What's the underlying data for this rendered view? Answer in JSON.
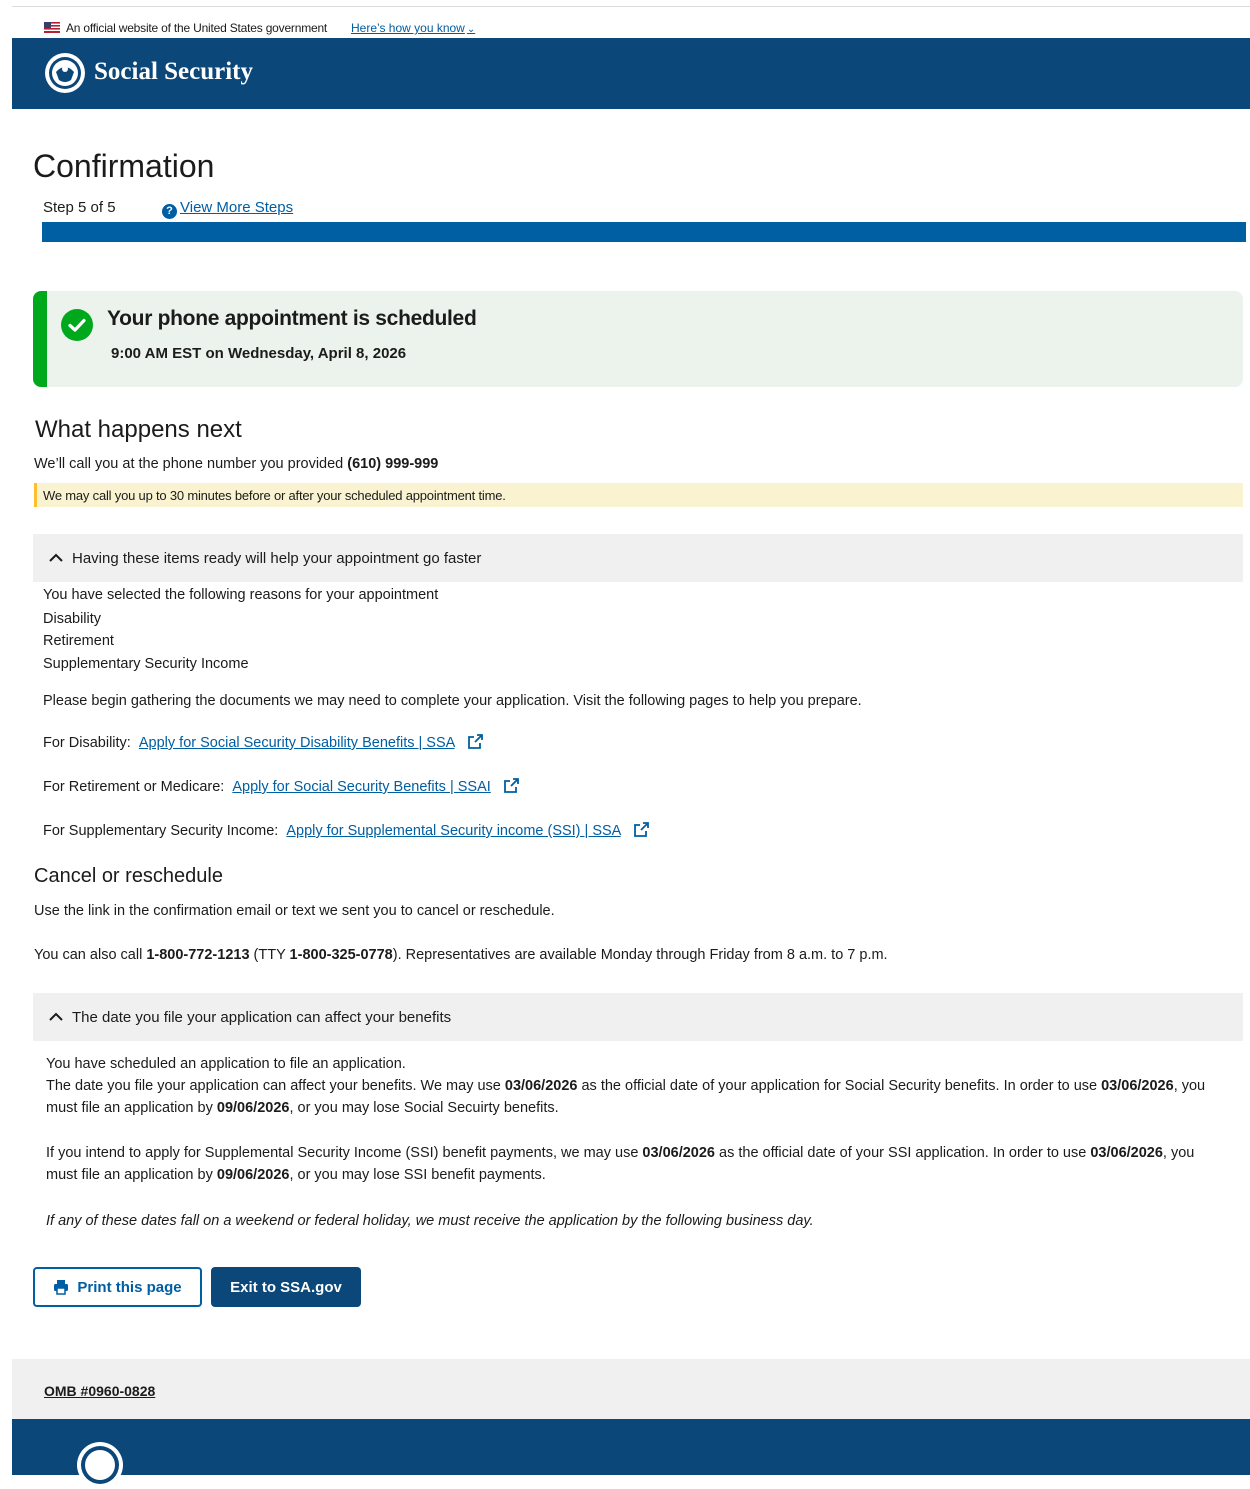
{
  "gov_banner": {
    "text": "An official website of the United States government",
    "link": "Here’s how you know"
  },
  "header": {
    "brand": "Social Security"
  },
  "page": {
    "title": "Confirmation",
    "step": "Step 5 of 5",
    "steps_link": "View More Steps",
    "progress_fraction": 1.0
  },
  "alert": {
    "heading": "Your phone appointment is scheduled",
    "time": "9:00 AM EST on Wednesday, April 8, 2026"
  },
  "next": {
    "heading": "What happens next",
    "call_prefix": "We’ll call you at the phone number you provided ",
    "phone": "(610) 999-999",
    "note": "We may call you up to 30 minutes before or after your scheduled appointment time."
  },
  "items_ready": {
    "toggle": "Having these items ready will help your appointment go faster",
    "reasons_intro": "You have selected the following reasons for your appointment",
    "reasons": [
      "Disability",
      "Retirement",
      "Supplementary Security Income"
    ],
    "gather": "Please begin gathering the documents we may need to complete your application. Visit the following pages to help you prepare.",
    "links": [
      {
        "label": "For Disability:",
        "link": "Apply for Social Security Disability Benefits  | SSA"
      },
      {
        "label": "For Retirement or Medicare:",
        "link": "Apply for Social Security Benefits | SSAI"
      },
      {
        "label": "For Supplementary Security Income:",
        "link": "Apply for Supplemental Security income (SSI)  | SSA"
      }
    ]
  },
  "cancel": {
    "heading": "Cancel or reschedule",
    "line1": "Use the link in the confirmation email or text we sent you to cancel or reschedule.",
    "line2_a": "You can also call ",
    "phone1": "1-800-772-1213",
    "line2_b": " (TTY ",
    "phone2": "1-800-325-0778",
    "line2_c": "). Representatives are available Monday through Friday from 8 a.m. to 7 p.m."
  },
  "date_section": {
    "toggle": "The date you file your application can affect your benefits",
    "p1_line1": "You have scheduled an application to file an application.",
    "p1_a": "The date you file your application can affect your benefits. We may use ",
    "date1": "03/06/2026",
    "p1_b": " as the official date of your application for Social Security benefits. In order to use ",
    "p1_c": ", you must file an application by ",
    "date2": "09/06/2026",
    "p1_d": ", or you may lose Social Secuirty benefits.",
    "p2_a": "If you intend to apply for Supplemental Security Income (SSI) benefit payments, we may use ",
    "p2_b": " as the official date of your SSI application. In order to use ",
    "p2_c": ", you must file an application by ",
    "p2_d": ", or you may lose SSI benefit payments.",
    "p3": "If any of these dates fall on a weekend or federal holiday, we must receive the application by the following business day."
  },
  "buttons": {
    "print": "Print this page",
    "exit": "Exit to SSA.gov"
  },
  "footer": {
    "omb": "OMB #0960-0828"
  },
  "colors": {
    "brand_navy": "#0b4778",
    "link_blue": "#005ea2",
    "success_green": "#00a91c",
    "warning_bg": "#faf3d1"
  }
}
